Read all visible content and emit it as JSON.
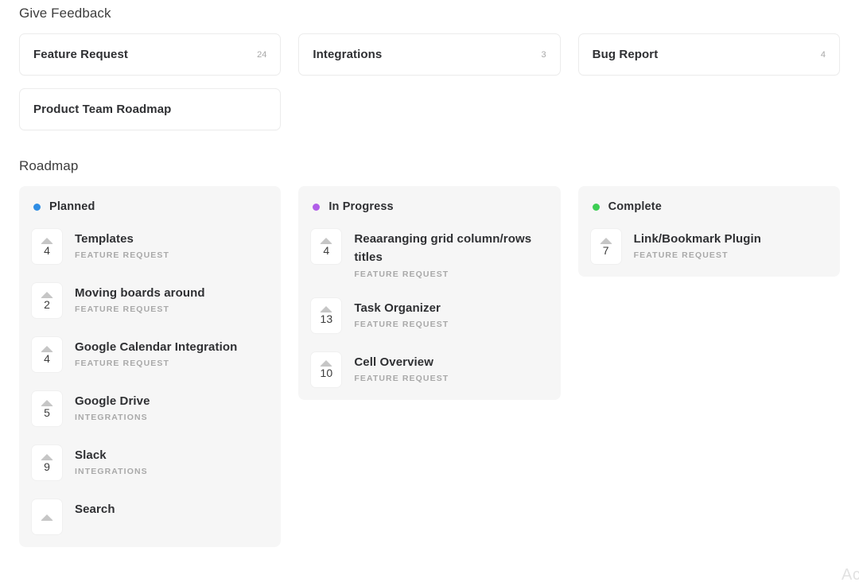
{
  "feedback": {
    "title": "Give Feedback",
    "boards": [
      {
        "name": "Feature Request",
        "count": "24"
      },
      {
        "name": "Integrations",
        "count": "3"
      },
      {
        "name": "Bug Report",
        "count": "4"
      },
      {
        "name": "Product Team Roadmap",
        "count": ""
      }
    ]
  },
  "roadmap": {
    "title": "Roadmap",
    "columns": [
      {
        "status": "Planned",
        "dot_color": "#2f8de4",
        "items": [
          {
            "votes": "4",
            "title": "Templates",
            "tag": "FEATURE REQUEST"
          },
          {
            "votes": "2",
            "title": "Moving boards around",
            "tag": "FEATURE REQUEST"
          },
          {
            "votes": "4",
            "title": "Google Calendar Integration",
            "tag": "FEATURE REQUEST"
          },
          {
            "votes": "5",
            "title": "Google Drive",
            "tag": "INTEGRATIONS"
          },
          {
            "votes": "9",
            "title": "Slack",
            "tag": "INTEGRATIONS"
          },
          {
            "votes": "",
            "title": "Search",
            "tag": ""
          }
        ]
      },
      {
        "status": "In Progress",
        "dot_color": "#b05ee8",
        "items": [
          {
            "votes": "4",
            "title": "Reaaranging grid column/rows titles",
            "tag": "FEATURE REQUEST"
          },
          {
            "votes": "13",
            "title": "Task Organizer",
            "tag": "FEATURE REQUEST"
          },
          {
            "votes": "10",
            "title": "Cell Overview",
            "tag": "FEATURE REQUEST"
          }
        ]
      },
      {
        "status": "Complete",
        "dot_color": "#3dce54",
        "items": [
          {
            "votes": "7",
            "title": "Link/Bookmark Plugin",
            "tag": "FEATURE REQUEST"
          }
        ]
      }
    ]
  },
  "corner": {
    "ghost_text": "Ac"
  },
  "vote_arrow_icon": "upvote-arrow-icon"
}
